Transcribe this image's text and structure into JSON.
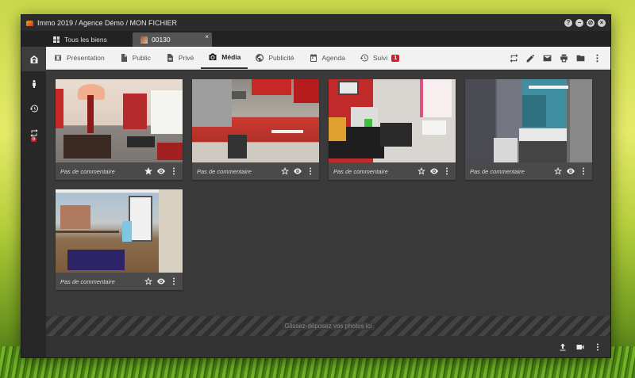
{
  "window": {
    "title": "Immo 2019 / Agence Démo / MON FICHIER",
    "controls": [
      "?",
      "–",
      "⊘",
      "×"
    ]
  },
  "tabs": [
    {
      "label": "Tous les biens"
    },
    {
      "label": "00130"
    }
  ],
  "sidebar": {
    "badge": "8"
  },
  "nav": [
    {
      "label": "Présentation"
    },
    {
      "label": "Public"
    },
    {
      "label": "Privé"
    },
    {
      "label": "Média"
    },
    {
      "label": "Publicité"
    },
    {
      "label": "Agenda"
    },
    {
      "label": "Suivi",
      "badge": "1"
    }
  ],
  "photos": [
    {
      "comment": "Pas de commentaire",
      "starred": true
    },
    {
      "comment": "Pas de commentaire",
      "starred": false
    },
    {
      "comment": "Pas de commentaire",
      "starred": false
    },
    {
      "comment": "Pas de commentaire",
      "starred": false
    },
    {
      "comment": "Pas de commentaire",
      "starred": false
    }
  ],
  "dropzone": {
    "text": "Glissez-déposez vos photos ici"
  },
  "colors": {
    "badge": "#d0202a",
    "window": "#333333",
    "toolbar": "#f2f2f2"
  }
}
